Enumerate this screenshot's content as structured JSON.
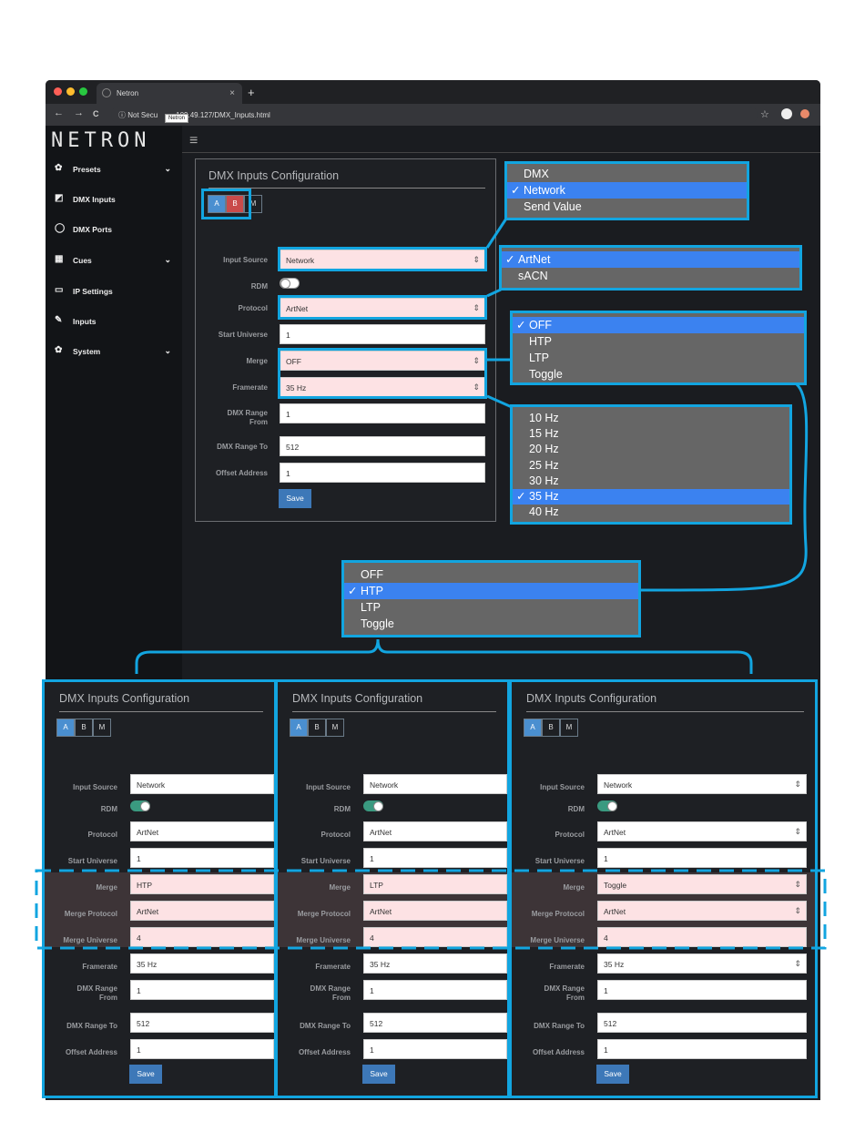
{
  "browser": {
    "tab_title": "Netron",
    "tab_close": "×",
    "new_tab": "+",
    "back": "←",
    "forward": "→",
    "reload": "C",
    "security": "Not Secu",
    "tooltip": "Netron",
    "url_rest": "109.49.127/DMX_Inputs.html",
    "star": "☆"
  },
  "app": {
    "logo": "NETRON",
    "sidebar": [
      {
        "label": "Presets",
        "icon": "gear-icon",
        "glyph": "✿",
        "chevron": "⌄"
      },
      {
        "label": "DMX Inputs",
        "icon": "input-icon",
        "glyph": "◩",
        "chevron": ""
      },
      {
        "label": "DMX Ports",
        "icon": "ring-icon",
        "glyph": "◯",
        "chevron": ""
      },
      {
        "label": "Cues",
        "icon": "film-icon",
        "glyph": "▦",
        "chevron": "⌄"
      },
      {
        "label": "IP Settings",
        "icon": "laptop-icon",
        "glyph": "▭",
        "chevron": ""
      },
      {
        "label": "Inputs",
        "icon": "plug-icon",
        "glyph": "✎",
        "chevron": ""
      },
      {
        "label": "System",
        "icon": "gear-icon",
        "glyph": "✿",
        "chevron": "⌄"
      }
    ]
  },
  "config": {
    "title": "DMX Inputs Configuration",
    "tabs": [
      "A",
      "B",
      "M"
    ],
    "labels": {
      "input_source": "Input Source",
      "rdm": "RDM",
      "protocol": "Protocol",
      "start_universe": "Start Universe",
      "merge": "Merge",
      "merge_protocol": "Merge Protocol",
      "merge_universe": "Merge Universe",
      "framerate": "Framerate",
      "dmx_range_from": "DMX Range From",
      "dmx_range_to": "DMX Range To",
      "offset_address": "Offset Address"
    },
    "save": "Save"
  },
  "top_form": {
    "input_source": "Network",
    "protocol": "ArtNet",
    "start_universe": "1",
    "merge": "OFF",
    "framerate": "35 Hz",
    "range_from": "1",
    "range_to": "512",
    "offset": "1"
  },
  "dropdowns": {
    "input_source": {
      "options": [
        "DMX",
        "Network",
        "Send Value"
      ],
      "selected": "Network"
    },
    "protocol": {
      "options": [
        "ArtNet",
        "sACN"
      ],
      "selected": "ArtNet"
    },
    "merge": {
      "options": [
        "OFF",
        "HTP",
        "LTP",
        "Toggle"
      ],
      "selected": "OFF"
    },
    "framerate": {
      "options": [
        "10 Hz",
        "15 Hz",
        "20 Hz",
        "25 Hz",
        "30 Hz",
        "35 Hz",
        "40 Hz"
      ],
      "selected": "35 Hz"
    },
    "merge_expanded": {
      "options": [
        "OFF",
        "HTP",
        "LTP",
        "Toggle"
      ],
      "selected": "HTP"
    }
  },
  "bottom_panels": [
    {
      "input_source": "Network",
      "protocol": "ArtNet",
      "start_universe": "1",
      "merge": "HTP",
      "merge_protocol": "ArtNet",
      "merge_universe": "4",
      "framerate": "35 Hz",
      "range_from": "1",
      "range_to": "512",
      "offset": "1"
    },
    {
      "input_source": "Network",
      "protocol": "ArtNet",
      "start_universe": "1",
      "merge": "LTP",
      "merge_protocol": "ArtNet",
      "merge_universe": "4",
      "framerate": "35 Hz",
      "range_from": "1",
      "range_to": "512",
      "offset": "1"
    },
    {
      "input_source": "Network",
      "protocol": "ArtNet",
      "start_universe": "1",
      "merge": "Toggle",
      "merge_protocol": "ArtNet",
      "merge_universe": "4",
      "framerate": "35 Hz",
      "range_from": "1",
      "range_to": "512",
      "offset": "1"
    }
  ],
  "colors": {
    "accent": "#12a5e0",
    "selected": "#3b82f0",
    "pink": "#fde2e4",
    "save": "#3d78b8"
  }
}
